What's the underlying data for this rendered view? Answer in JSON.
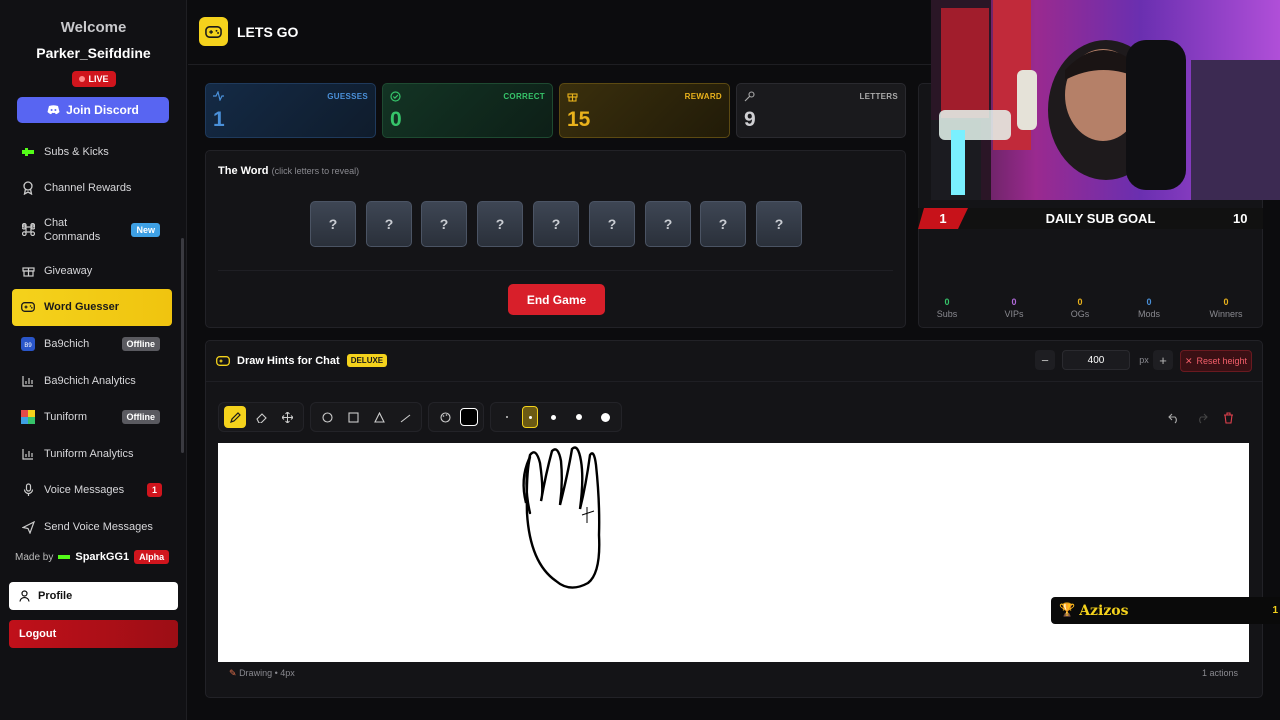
{
  "sidebar": {
    "welcome": "Welcome",
    "username": "Parker_Seifddine",
    "live": "LIVE",
    "discord": "Join Discord",
    "items": [
      {
        "label": "Subs & Kicks",
        "icon": "kick-icon"
      },
      {
        "label": "Channel Rewards",
        "icon": "award-icon"
      },
      {
        "label": "Chat Commands",
        "icon": "command-icon",
        "badge": "New"
      },
      {
        "label": "Giveaway",
        "icon": "gift-icon"
      },
      {
        "label": "Word Guesser",
        "icon": "gamepad-icon"
      },
      {
        "label": "Ba9chich",
        "icon": "ba9chich-logo-icon",
        "badge": "Offline"
      },
      {
        "label": "Ba9chich Analytics",
        "icon": "chart-icon"
      },
      {
        "label": "Tuniform",
        "icon": "tuniform-logo-icon",
        "badge": "Offline"
      },
      {
        "label": "Tuniform Analytics",
        "icon": "chart-icon"
      },
      {
        "label": "Voice Messages",
        "icon": "mic-icon",
        "badge": "1"
      },
      {
        "label": "Send Voice Messages",
        "icon": "send-icon"
      }
    ],
    "made_by": "Made by",
    "maker": "SparkGG1",
    "alpha": "Alpha",
    "profile": "Profile",
    "logout": "Logout"
  },
  "header": {
    "title": "LETS GO"
  },
  "stats": {
    "guesses": {
      "label": "GUESSES",
      "value": "1",
      "color": "#4a90d9"
    },
    "correct": {
      "label": "CORRECT",
      "value": "0",
      "color": "#36c46a"
    },
    "reward": {
      "label": "REWARD",
      "value": "15",
      "color": "#e9b21c"
    },
    "letters": {
      "label": "LETTERS",
      "value": "9",
      "color": "#9a9aa0"
    }
  },
  "word": {
    "title": "The Word",
    "hint": "(click letters to reveal)",
    "tiles": [
      "?",
      "?",
      "?",
      "?",
      "?",
      "?",
      "?",
      "?",
      "?"
    ],
    "end_button": "End Game"
  },
  "stream": {
    "goal_number": "1",
    "goal_title": "DAILY SUB GOAL",
    "goal_target": "10",
    "counters": [
      {
        "label": "Subs",
        "value": "0",
        "color": "#36c46a"
      },
      {
        "label": "VIPs",
        "value": "0",
        "color": "#b06ad9"
      },
      {
        "label": "OGs",
        "value": "0",
        "color": "#e9b21c"
      },
      {
        "label": "Mods",
        "value": "0",
        "color": "#4a90d9"
      },
      {
        "label": "Winners",
        "value": "0",
        "color": "#e9b21c"
      }
    ]
  },
  "draw": {
    "title": "Draw Hints for Chat",
    "deluxe": "DELUXE",
    "height_value": "400",
    "height_unit": "px",
    "reset": "Reset height",
    "status": "Drawing • 4px",
    "actions": "1 actions"
  },
  "overlay": {
    "name": "Azizos",
    "count": "1"
  }
}
